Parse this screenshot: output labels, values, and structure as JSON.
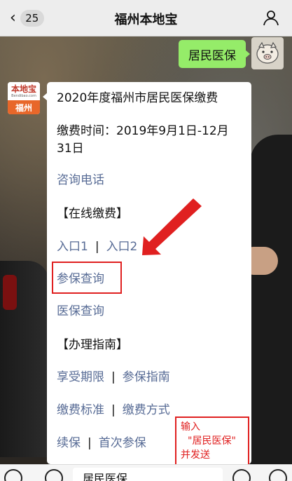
{
  "header": {
    "back_count": "25",
    "title": "福州本地宝"
  },
  "chat": {
    "sent_message": "居民医保",
    "sender_avatar": {
      "logo": "本地宝",
      "sub": "Bendibao.com",
      "city": "福州"
    },
    "card": {
      "title": "2020年度福州市居民医保缴费",
      "time_line1": "缴费时间：2019年9月1日-12月",
      "time_line2": "31日",
      "consult_phone": "咨询电话",
      "online_pay_header": "【在线缴费】",
      "entry1": "入口1",
      "entry2": "入口2",
      "insured_query": "参保查询",
      "medical_query": "医保查询",
      "guide_header": "【办理指南】",
      "benefit_period": "享受期限",
      "insured_guide": "参保指南",
      "pay_standard": "缴费标准",
      "pay_method": "缴费方式",
      "renew": "续保",
      "first_insured": "首次参保",
      "separator": "|"
    }
  },
  "annotation": {
    "line1": "输入",
    "line2": "\"居民医保\"",
    "line3": "并发送"
  },
  "input_bar": {
    "text": "居民医保"
  },
  "colors": {
    "link": "#576b95",
    "sent_bubble": "#95ec69",
    "annotation_red": "#e02020"
  }
}
